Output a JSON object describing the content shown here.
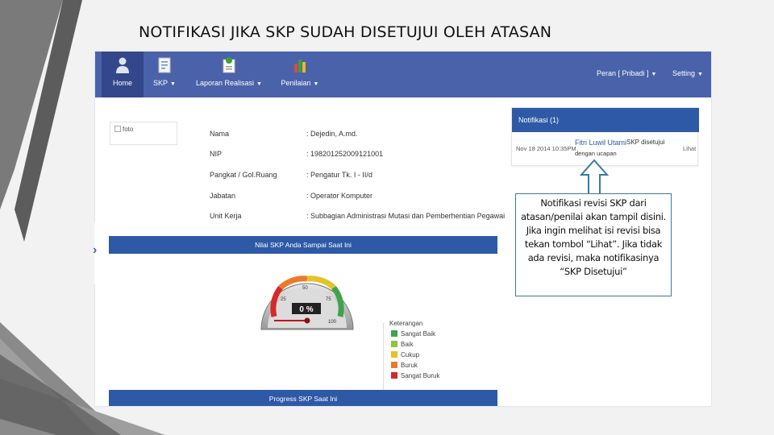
{
  "slide": {
    "title": "NOTIFIKASI JIKA SKP SUDAH DISETUJUI OLEH ATASAN"
  },
  "navbar": {
    "items": [
      {
        "label": "Home",
        "icon": "user-icon"
      },
      {
        "label": "SKP",
        "icon": "document-icon"
      },
      {
        "label": "Laporan Realisasi",
        "icon": "report-icon"
      },
      {
        "label": "Penilaian",
        "icon": "bar-chart-icon"
      }
    ],
    "right": [
      {
        "label": "Peran [ Pribadi ]"
      },
      {
        "label": "Setting"
      }
    ]
  },
  "profile": {
    "photo_alt": "foto",
    "fields": [
      {
        "key": "Nama",
        "value": ": Dejedin, A.md."
      },
      {
        "key": "NIP",
        "value": ": 198201252009121001"
      },
      {
        "key": "Pangkat / Gol.Ruang",
        "value": ": Pengatur Tk. I - II/d"
      },
      {
        "key": "Jabatan",
        "value": ": Operator Komputer"
      },
      {
        "key": "Unit Kerja",
        "value": ": Subbagian Administrasi Mutasi dan Pemberhentian Pegawai"
      }
    ]
  },
  "gauge": {
    "header": "Nilai SKP Anda Sampai Saat Ini",
    "value": 0,
    "readout": "0 %",
    "ticks": [
      "25",
      "50",
      "75",
      "100"
    ],
    "legend_title": "Keterangan",
    "legend": [
      {
        "label": "Sangat Baik",
        "color": "#3fa34d"
      },
      {
        "label": "Baik",
        "color": "#8cc63f"
      },
      {
        "label": "Cukup",
        "color": "#e3c325"
      },
      {
        "label": "Buruk",
        "color": "#ec7a2a"
      },
      {
        "label": "Sangat Buruk",
        "color": "#d42a2a"
      }
    ]
  },
  "progress": {
    "header": "Progress SKP Saat Ini"
  },
  "notification": {
    "header": "Notifikasi (1)",
    "time": "Nov 18 2014 10:35PM",
    "user": "Fitri Luwil Utami",
    "message": "SKP disetujui",
    "sub": "dengan ucapan",
    "button": "Lihat"
  },
  "callout": {
    "text": "Notifikasi revisi SKP dari atasan/penilai akan tampil disini. Jika ingin melihat isi revisi bisa tekan tombol “Lihat”. Jika tidak ada revisi, maka notifikasinya “SKP Disetujui”"
  },
  "colors": {
    "navbar": "#4a62a9",
    "header_bar": "#2e59a6",
    "callout_border": "#3a7a9c"
  }
}
